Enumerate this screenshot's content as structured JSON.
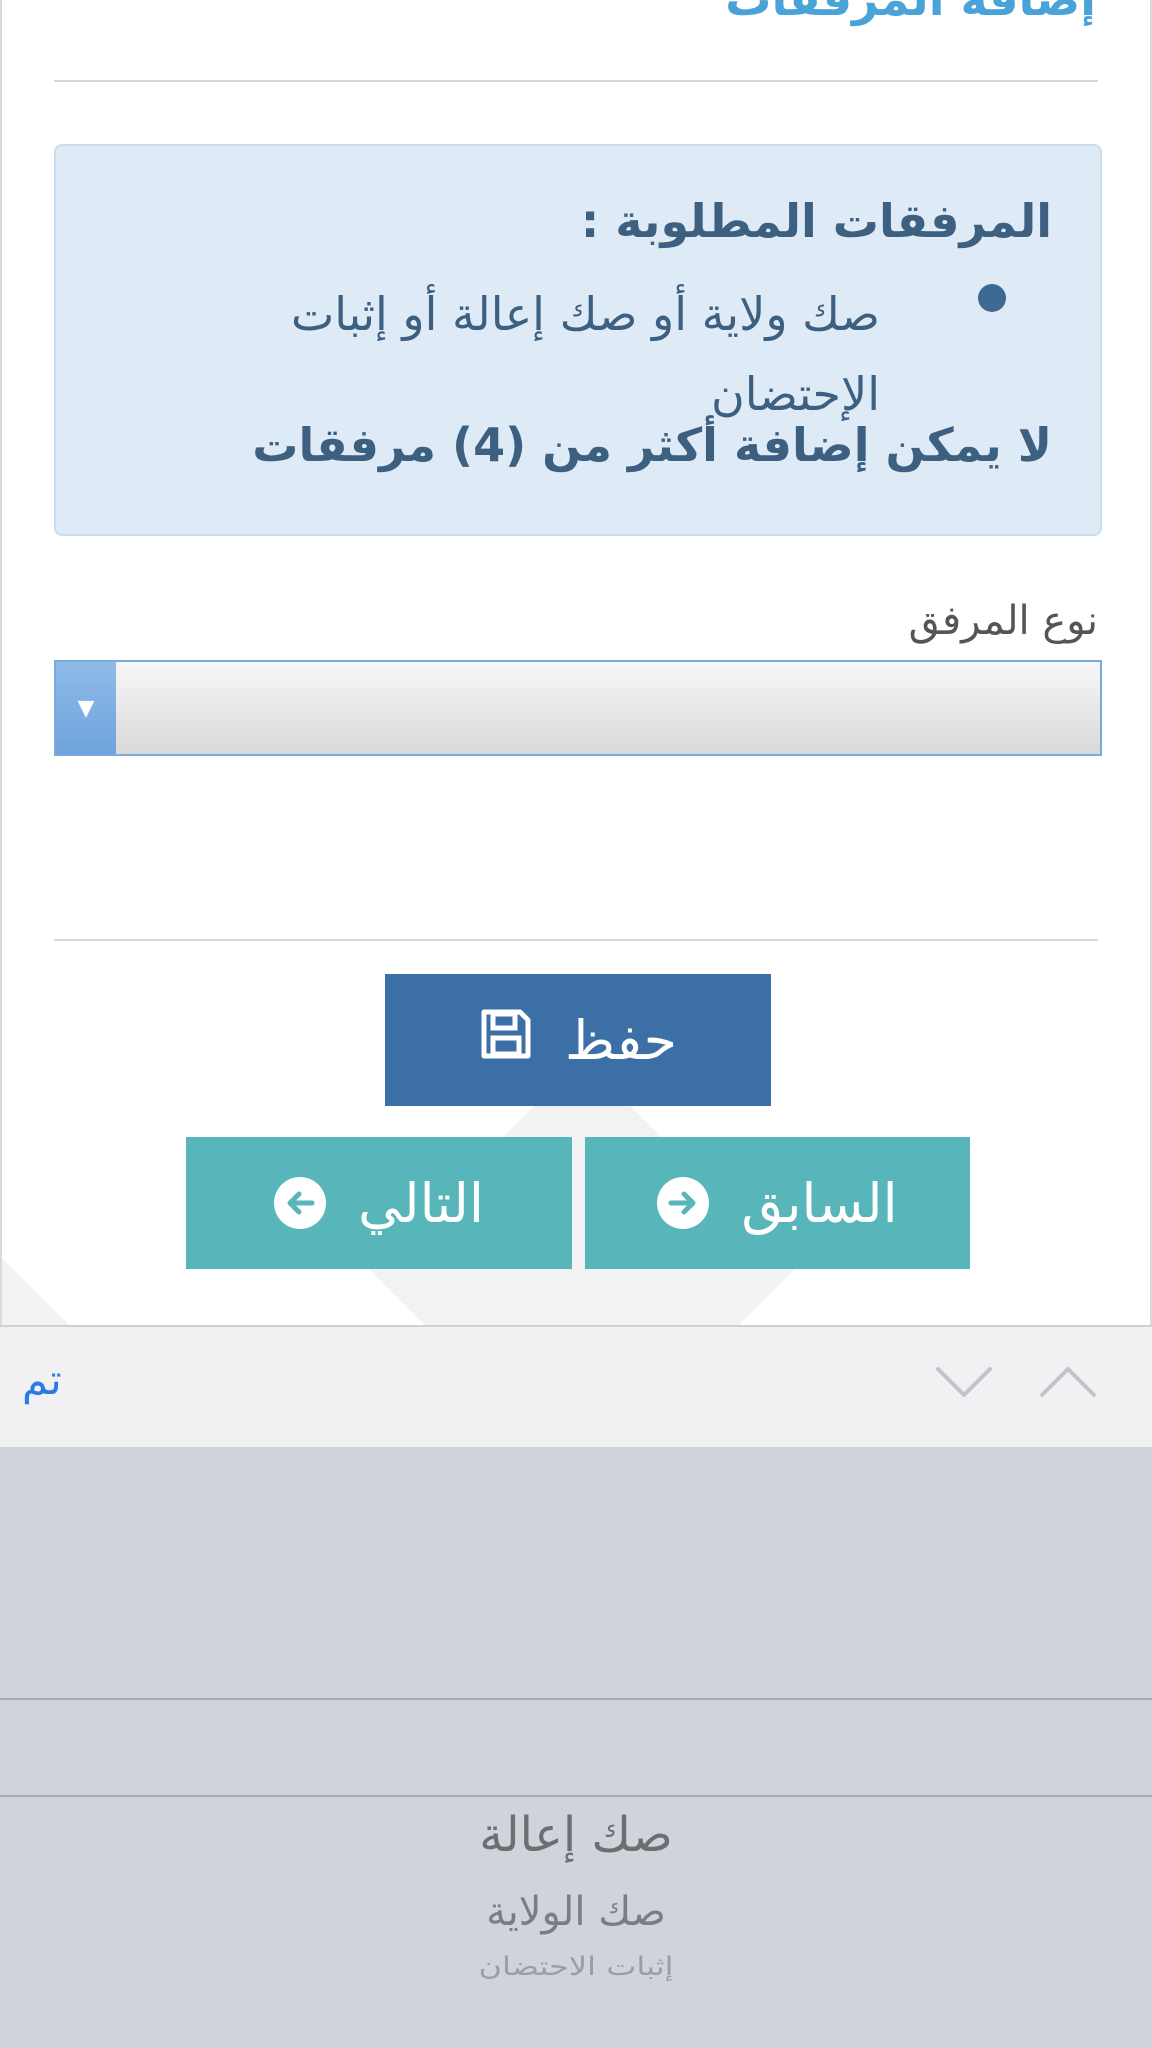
{
  "page": {
    "heading": "إضافة المرفقات"
  },
  "info": {
    "title": "المرفقات المطلوبة :",
    "items": [
      "صك ولاية أو صك إعالة أو إثبات الإحتضان"
    ],
    "note": "لا يمكن إضافة أكثر من (4) مرفقات"
  },
  "form": {
    "attachment_type_label": "نوع المرفق",
    "attachment_type_value": ""
  },
  "buttons": {
    "save": "حفظ",
    "previous": "السابق",
    "next": "التالي"
  },
  "keyboard_toolbar": {
    "done": "تم"
  },
  "picker": {
    "options": [
      "صك إعالة",
      "صك الولاية",
      "إثبات الاحتضان"
    ]
  },
  "colors": {
    "heading": "#4aa3d8",
    "info_bg": "#deebf7",
    "save_button": "#3c6fa6",
    "nav_buttons": "#58b6ba",
    "done_link": "#2c7be5"
  },
  "icons": {
    "save": "floppy-disk-icon",
    "previous": "circle-arrow-right-icon",
    "next": "circle-arrow-left-icon",
    "select": "triangle-down-icon",
    "toolbar_prev": "chevron-up-icon",
    "toolbar_next": "chevron-down-icon"
  }
}
